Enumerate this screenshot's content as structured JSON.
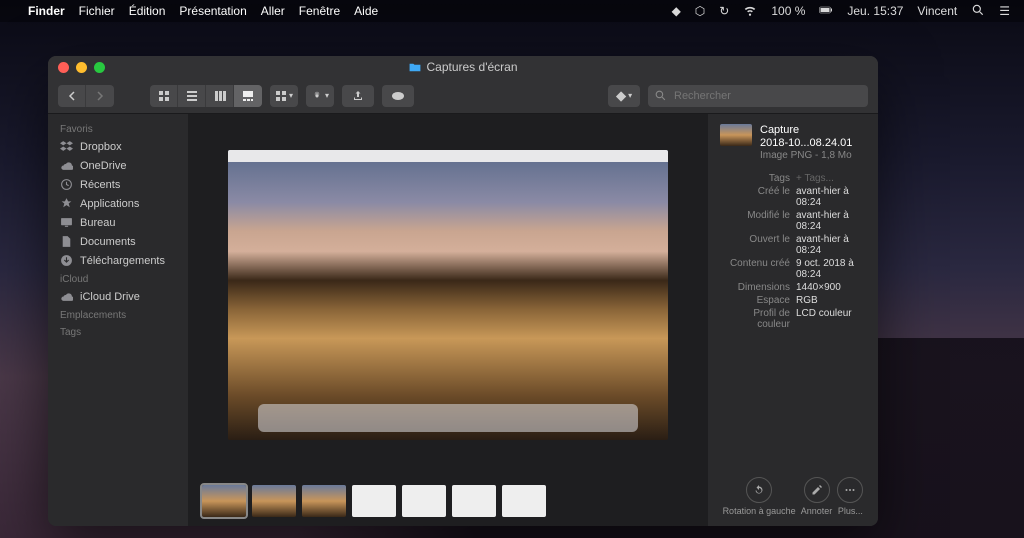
{
  "menubar": {
    "app": "Finder",
    "items": [
      "Fichier",
      "Édition",
      "Présentation",
      "Aller",
      "Fenêtre",
      "Aide"
    ],
    "battery": "100 %",
    "clock": "Jeu. 15:37",
    "user": "Vincent"
  },
  "window": {
    "title": "Captures d'écran",
    "search_placeholder": "Rechercher"
  },
  "sidebar": {
    "groups": [
      {
        "label": "Favoris",
        "items": [
          {
            "icon": "dropbox-icon",
            "label": "Dropbox"
          },
          {
            "icon": "cloud-icon",
            "label": "OneDrive"
          },
          {
            "icon": "clock-icon",
            "label": "Récents"
          },
          {
            "icon": "apps-icon",
            "label": "Applications"
          },
          {
            "icon": "desktop-icon",
            "label": "Bureau"
          },
          {
            "icon": "documents-icon",
            "label": "Documents"
          },
          {
            "icon": "downloads-icon",
            "label": "Téléchargements"
          }
        ]
      },
      {
        "label": "iCloud",
        "items": [
          {
            "icon": "icloud-icon",
            "label": "iCloud Drive"
          }
        ]
      },
      {
        "label": "Emplacements",
        "items": []
      },
      {
        "label": "Tags",
        "items": []
      }
    ]
  },
  "file": {
    "name_line1": "Capture",
    "name_line2": "2018-10...08.24.01",
    "kind": "Image PNG - 1,8 Mo",
    "meta": [
      {
        "label": "Tags",
        "value": "+ Tags...",
        "muted": true
      },
      {
        "label": "Créé le",
        "value": "avant-hier à 08:24"
      },
      {
        "label": "Modifié le",
        "value": "avant-hier à 08:24"
      },
      {
        "label": "Ouvert le",
        "value": "avant-hier à 08:24"
      },
      {
        "label": "Contenu créé",
        "value": "9 oct. 2018 à 08:24"
      },
      {
        "label": "Dimensions",
        "value": "1440×900"
      },
      {
        "label": "Espace",
        "value": "RGB"
      },
      {
        "label": "Profil de couleur",
        "value": "LCD couleur"
      }
    ]
  },
  "actions": {
    "rotate": "Rotation à gauche",
    "annotate": "Annoter",
    "more": "Plus..."
  },
  "thumbnails": [
    {
      "kind": "dune",
      "selected": true
    },
    {
      "kind": "dune",
      "selected": false
    },
    {
      "kind": "dune",
      "selected": false
    },
    {
      "kind": "doc",
      "selected": false
    },
    {
      "kind": "doc",
      "selected": false
    },
    {
      "kind": "doc",
      "selected": false
    },
    {
      "kind": "doc",
      "selected": false
    }
  ]
}
